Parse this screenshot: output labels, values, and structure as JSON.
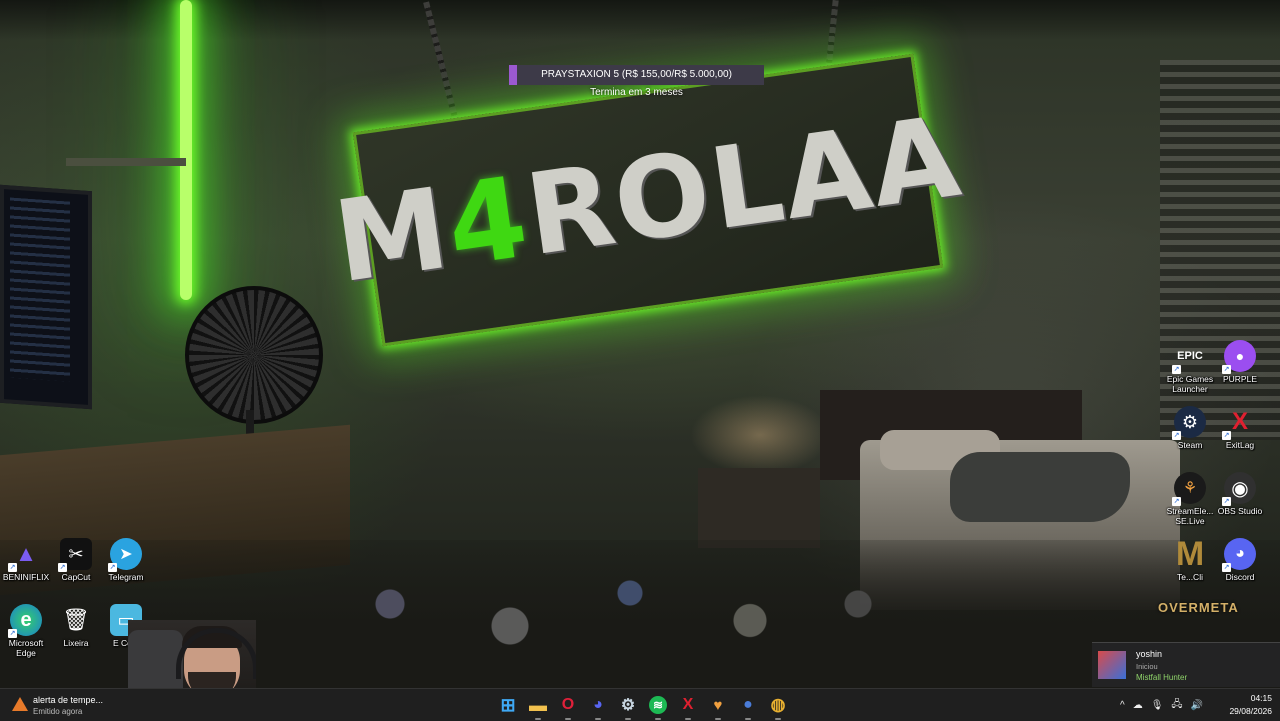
{
  "goal": {
    "label": "PRAYSTAXION 5 (R$ 155,00/R$ 5.000,00)",
    "progress_fraction": 0.031,
    "subtitle": "Termina em 3 meses",
    "fill_color": "#9b59d0"
  },
  "wallpaper": {
    "sign_text_before": "M",
    "sign_text_accent": "4",
    "sign_text_after": "ROLAA",
    "accent_color": "#3fd812"
  },
  "desktop_left": [
    {
      "label": "BENINIFLIX",
      "icon": "beniniflix-icon",
      "glyph": "▲",
      "color": "#7a5cf0"
    },
    {
      "label": "CapCut",
      "icon": "capcut-icon",
      "glyph": "✂",
      "color": "#ffffff"
    },
    {
      "label": "Telegram",
      "icon": "telegram-icon",
      "glyph": "➤",
      "color": "#2aa3e0"
    },
    {
      "label": "Microsoft Edge",
      "icon": "edge-icon",
      "glyph": "e",
      "color": "#1fa5d8"
    },
    {
      "label": "Lixeira",
      "icon": "recycle-bin-icon",
      "glyph": "🗑",
      "color": "#8fb8d8"
    },
    {
      "label": "E Com",
      "icon": "computer-icon",
      "glyph": "▭",
      "color": "#4bb8e0"
    }
  ],
  "desktop_right": [
    {
      "label": "Epic Games Launcher",
      "icon": "epic-games-icon",
      "glyph": "EPIC",
      "color": "#ffffff"
    },
    {
      "label": "PURPLE",
      "icon": "purple-icon",
      "glyph": "●",
      "color": "#9b4ef0"
    },
    {
      "label": "Steam",
      "icon": "steam-icon",
      "glyph": "⚙",
      "color": "#1b2a44"
    },
    {
      "label": "ExitLag",
      "icon": "exitlag-icon",
      "glyph": "X",
      "color": "#e02030"
    },
    {
      "label": "StreamEle... SE.Live",
      "icon": "streamelements-icon",
      "glyph": "⚘",
      "color": "#1a1a1a"
    },
    {
      "label": "OBS Studio",
      "icon": "obs-icon",
      "glyph": "◉",
      "color": "#303030"
    },
    {
      "label": "Te...Cli",
      "icon": "overmeta-logo-icon",
      "glyph": "M",
      "color": "#b08a3a"
    },
    {
      "label": "Discord",
      "icon": "discord-icon",
      "glyph": "◕",
      "color": "#5865f2"
    }
  ],
  "overlay_text": "OVERMETA",
  "toast": {
    "name": "yoshin",
    "action": "Iniciou",
    "game": "Mistfall Hunter"
  },
  "notification": {
    "title": "alerta de tempe...",
    "subtitle": "Emitido agora"
  },
  "taskbar_apps": [
    {
      "name": "start",
      "icon": "windows-start-icon",
      "glyph": "⊞",
      "color": "#3fa9f5"
    },
    {
      "name": "file-explorer",
      "icon": "folder-icon",
      "glyph": "▬",
      "color": "#f2c14e"
    },
    {
      "name": "opera",
      "icon": "opera-icon",
      "glyph": "O",
      "color": "#e0203a"
    },
    {
      "name": "discord",
      "icon": "discord-icon",
      "glyph": "◕",
      "color": "#5865f2"
    },
    {
      "name": "steam",
      "icon": "steam-icon",
      "glyph": "⚙",
      "color": "#c7d5e0"
    },
    {
      "name": "spotify",
      "icon": "spotify-icon",
      "glyph": "≋",
      "color": "#1db954"
    },
    {
      "name": "exitlag",
      "icon": "exitlag-icon",
      "glyph": "X",
      "color": "#e02030"
    },
    {
      "name": "app",
      "icon": "app-icon",
      "glyph": "♥",
      "color": "#f0a040"
    },
    {
      "name": "app2",
      "icon": "blue-orb-icon",
      "glyph": "●",
      "color": "#4a7cd8"
    },
    {
      "name": "chrome",
      "icon": "chrome-icon",
      "glyph": "◍",
      "color": "#e8b030"
    }
  ],
  "tray": {
    "chevron": "^",
    "icons": [
      "☁",
      "🎙",
      "🖧",
      "🔊"
    ],
    "time": "04:15",
    "date": "29/08/2026"
  }
}
